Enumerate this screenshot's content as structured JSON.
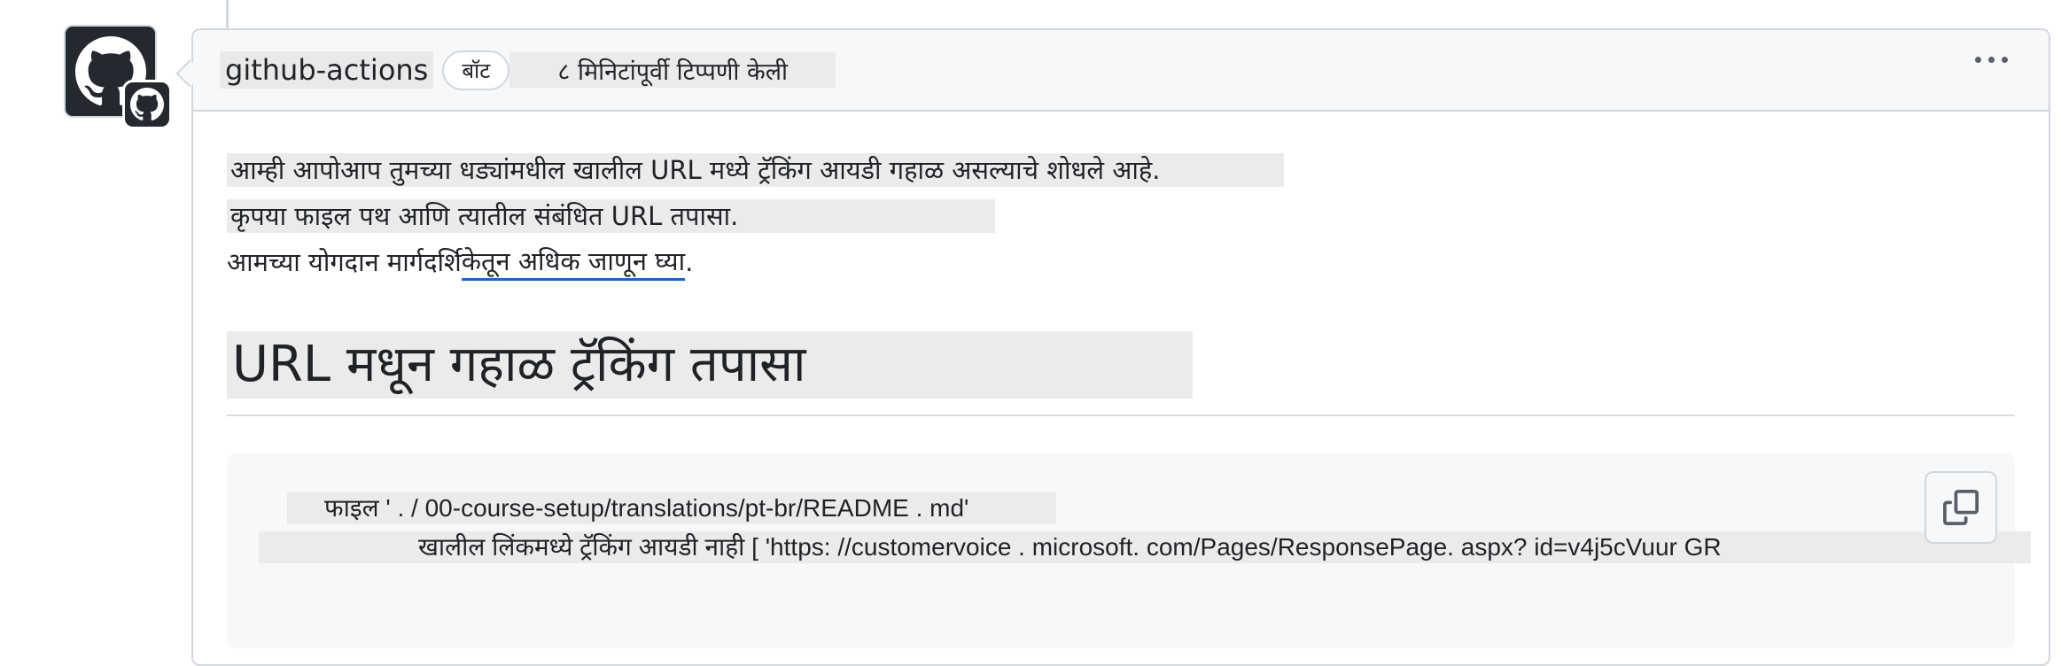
{
  "comment": {
    "author": "github-actions",
    "bot_badge": "बॉट",
    "timestamp": "८ मिनिटांपूर्वी टिप्पणी केली",
    "body": {
      "line1": "आम्ही आपोआप तुमच्या धड्यांमधील खालील URL मध्ये ट्रॅकिंग आयडी गहाळ असल्याचे शोधले आहे.",
      "line2": "कृपया फाइल पथ आणि त्यातील संबंधित URL तपासा.",
      "line3_prefix": "आमच्या योगदान मार्गदर्शि",
      "line3_link": "केतून अधिक जाणून घ्या",
      "line3_suffix": "."
    },
    "heading": "URL मधून गहाळ ट्रॅकिंग तपासा",
    "code": {
      "line1": "फाइल ' . / 00-course-setup/translations/pt-br/README . md'",
      "line2": "खालील लिंकमध्ये ट्रॅकिंग आयडी नाही [ 'https: //customervoice . microsoft. com/Pages/ResponsePage. aspx? id=v4j5cVuur GR"
    }
  },
  "icons": {
    "avatar": "github-octocat-icon",
    "badge": "github-octocat-icon",
    "menu": "kebab-menu-icon",
    "copy": "copy-icon"
  },
  "colors": {
    "link_underline": "#0969da",
    "border": "#d0d7de",
    "header_bg": "#f6f8fa"
  }
}
